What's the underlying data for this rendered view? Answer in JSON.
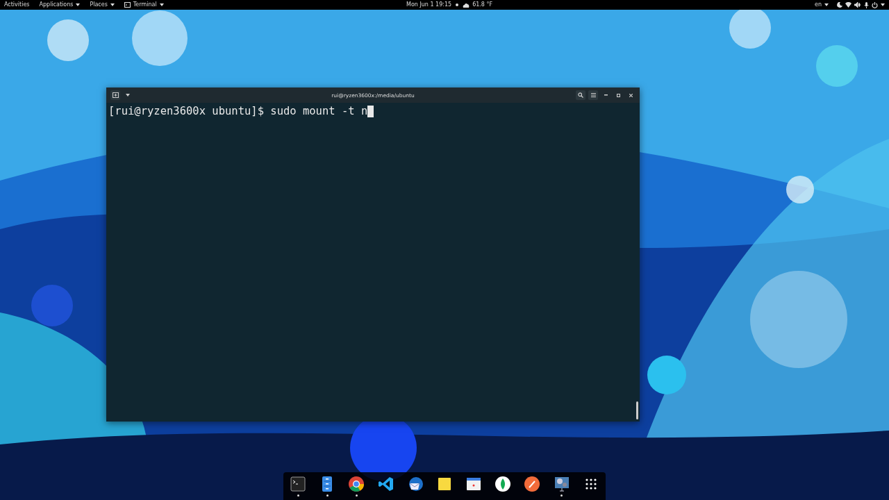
{
  "top_bar": {
    "activities": "Activities",
    "menus": [
      {
        "label": "Applications",
        "kind": "menu"
      },
      {
        "label": "Places",
        "kind": "menu"
      },
      {
        "label": "Terminal",
        "kind": "app"
      }
    ],
    "clock": "Mon Jun 1  19:15",
    "weather": "61.8 °F",
    "language": "en"
  },
  "terminal": {
    "title": "rui@ryzen3600x:/media/ubuntu",
    "lines": [
      "[rui@ryzen3600x ubuntu]$ sudo mount -t n"
    ]
  },
  "dock": [
    {
      "kind": "terminal",
      "running": true
    },
    {
      "kind": "files",
      "running": true
    },
    {
      "kind": "chrome",
      "running": true
    },
    {
      "kind": "code",
      "running": false
    },
    {
      "kind": "mail",
      "running": false
    },
    {
      "kind": "notes",
      "running": false
    },
    {
      "kind": "calendar",
      "running": false
    },
    {
      "kind": "leaf",
      "running": false
    },
    {
      "kind": "postman",
      "running": false
    },
    {
      "kind": "display",
      "running": true
    },
    {
      "kind": "apps",
      "running": false
    }
  ]
}
